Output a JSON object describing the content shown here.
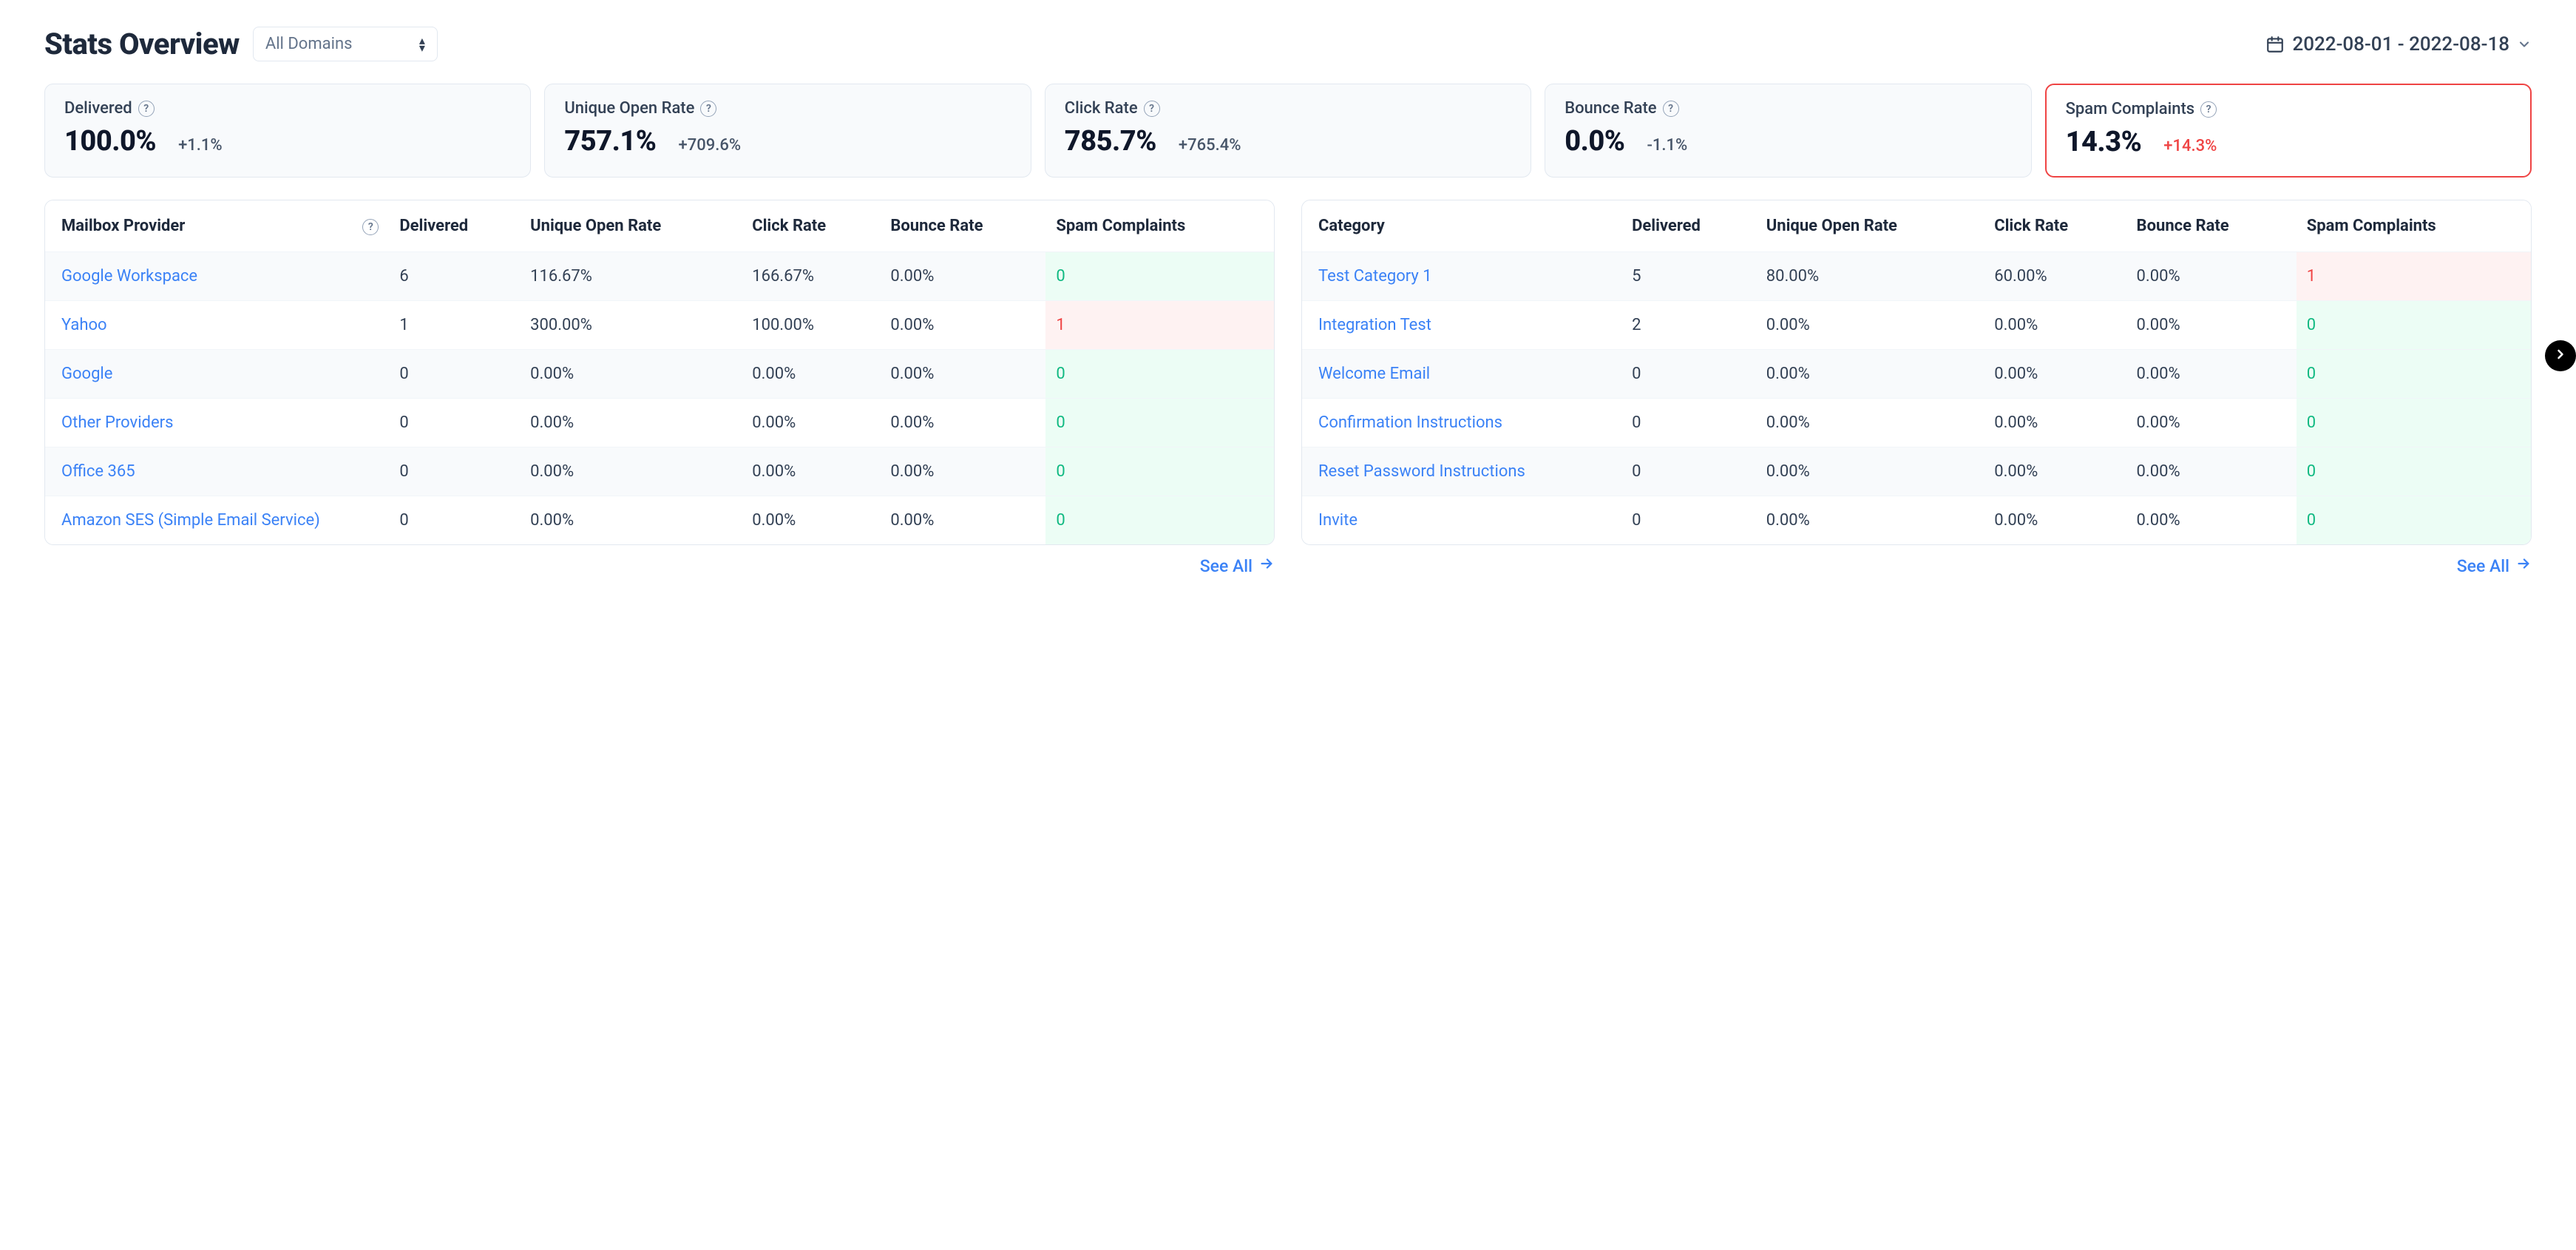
{
  "header": {
    "title": "Stats Overview",
    "domain_select_label": "All Domains",
    "date_range_label": "2022-08-01 - 2022-08-18"
  },
  "cards": [
    {
      "label": "Delivered",
      "value": "100.0%",
      "delta": "+1.1%",
      "danger": false
    },
    {
      "label": "Unique Open Rate",
      "value": "757.1%",
      "delta": "+709.6%",
      "danger": false
    },
    {
      "label": "Click Rate",
      "value": "785.7%",
      "delta": "+765.4%",
      "danger": false
    },
    {
      "label": "Bounce Rate",
      "value": "0.0%",
      "delta": "-1.1%",
      "danger": false
    },
    {
      "label": "Spam Complaints",
      "value": "14.3%",
      "delta": "+14.3%",
      "danger": true
    }
  ],
  "provider_table": {
    "headers": [
      "Mailbox Provider",
      "Delivered",
      "Unique Open Rate",
      "Click Rate",
      "Bounce Rate",
      "Spam Complaints"
    ],
    "rows": [
      {
        "name": "Google Workspace",
        "delivered": "6",
        "open": "116.67%",
        "click": "166.67%",
        "bounce": "0.00%",
        "spam": "0",
        "spam_bad": false
      },
      {
        "name": "Yahoo",
        "delivered": "1",
        "open": "300.00%",
        "click": "100.00%",
        "bounce": "0.00%",
        "spam": "1",
        "spam_bad": true
      },
      {
        "name": "Google",
        "delivered": "0",
        "open": "0.00%",
        "click": "0.00%",
        "bounce": "0.00%",
        "spam": "0",
        "spam_bad": false
      },
      {
        "name": "Other Providers",
        "delivered": "0",
        "open": "0.00%",
        "click": "0.00%",
        "bounce": "0.00%",
        "spam": "0",
        "spam_bad": false
      },
      {
        "name": "Office 365",
        "delivered": "0",
        "open": "0.00%",
        "click": "0.00%",
        "bounce": "0.00%",
        "spam": "0",
        "spam_bad": false
      },
      {
        "name": "Amazon SES (Simple Email Service)",
        "delivered": "0",
        "open": "0.00%",
        "click": "0.00%",
        "bounce": "0.00%",
        "spam": "0",
        "spam_bad": false
      }
    ],
    "see_all_label": "See All"
  },
  "category_table": {
    "headers": [
      "Category",
      "Delivered",
      "Unique Open Rate",
      "Click Rate",
      "Bounce Rate",
      "Spam Complaints"
    ],
    "rows": [
      {
        "name": "Test Category 1",
        "delivered": "5",
        "open": "80.00%",
        "click": "60.00%",
        "bounce": "0.00%",
        "spam": "1",
        "spam_bad": true
      },
      {
        "name": "Integration Test",
        "delivered": "2",
        "open": "0.00%",
        "click": "0.00%",
        "bounce": "0.00%",
        "spam": "0",
        "spam_bad": false
      },
      {
        "name": "Welcome Email",
        "delivered": "0",
        "open": "0.00%",
        "click": "0.00%",
        "bounce": "0.00%",
        "spam": "0",
        "spam_bad": false
      },
      {
        "name": "Confirmation Instructions",
        "delivered": "0",
        "open": "0.00%",
        "click": "0.00%",
        "bounce": "0.00%",
        "spam": "0",
        "spam_bad": false
      },
      {
        "name": "Reset Password Instructions",
        "delivered": "0",
        "open": "0.00%",
        "click": "0.00%",
        "bounce": "0.00%",
        "spam": "0",
        "spam_bad": false
      },
      {
        "name": "Invite",
        "delivered": "0",
        "open": "0.00%",
        "click": "0.00%",
        "bounce": "0.00%",
        "spam": "0",
        "spam_bad": false
      }
    ],
    "see_all_label": "See All"
  }
}
